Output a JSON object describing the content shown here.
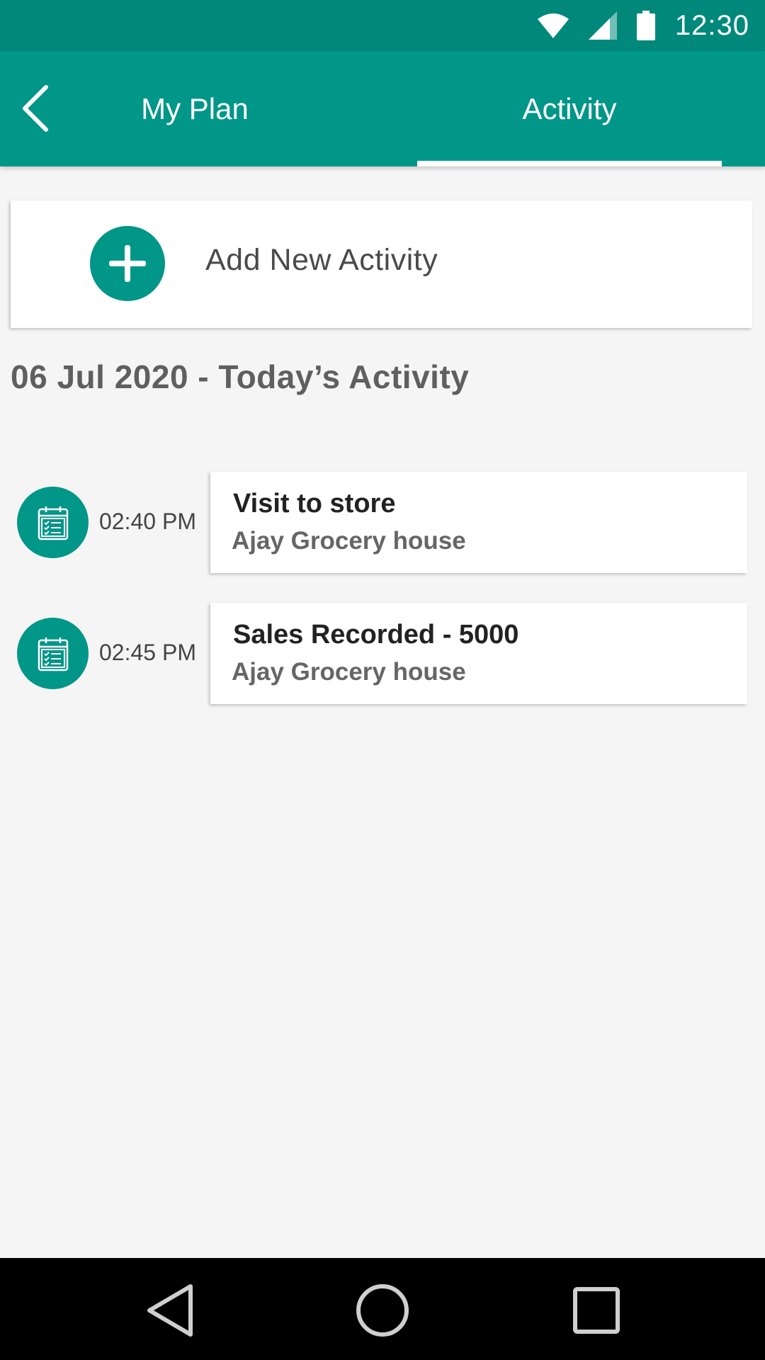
{
  "status_bar": {
    "time": "12:30",
    "icons": [
      "wifi-icon",
      "cellular-signal-icon",
      "battery-icon"
    ]
  },
  "app_bar": {
    "back_icon": "chevron-left-icon",
    "tabs": [
      {
        "label": "My Plan",
        "selected": false
      },
      {
        "label": "Activity",
        "selected": true
      }
    ]
  },
  "add_activity": {
    "label": "Add New Activity",
    "icon": "plus-icon"
  },
  "section": {
    "heading": "06 Jul 2020 - Today’s Activity"
  },
  "activities": [
    {
      "time": "02:40 PM",
      "title": "Visit to store",
      "subtitle": "Ajay Grocery house",
      "icon": "calendar-checklist-icon"
    },
    {
      "time": "02:45 PM",
      "title": "Sales Recorded - 5000",
      "subtitle": "Ajay Grocery house",
      "icon": "calendar-checklist-icon"
    }
  ],
  "nav_bar": {
    "icons": [
      "nav-back-icon",
      "nav-home-icon",
      "nav-recents-icon"
    ]
  },
  "colors": {
    "primary": "#009688",
    "primary_dark": "#00897b",
    "background": "#f5f5f5",
    "card": "#ffffff",
    "title_text": "#222222",
    "subtitle_text": "#666666"
  }
}
